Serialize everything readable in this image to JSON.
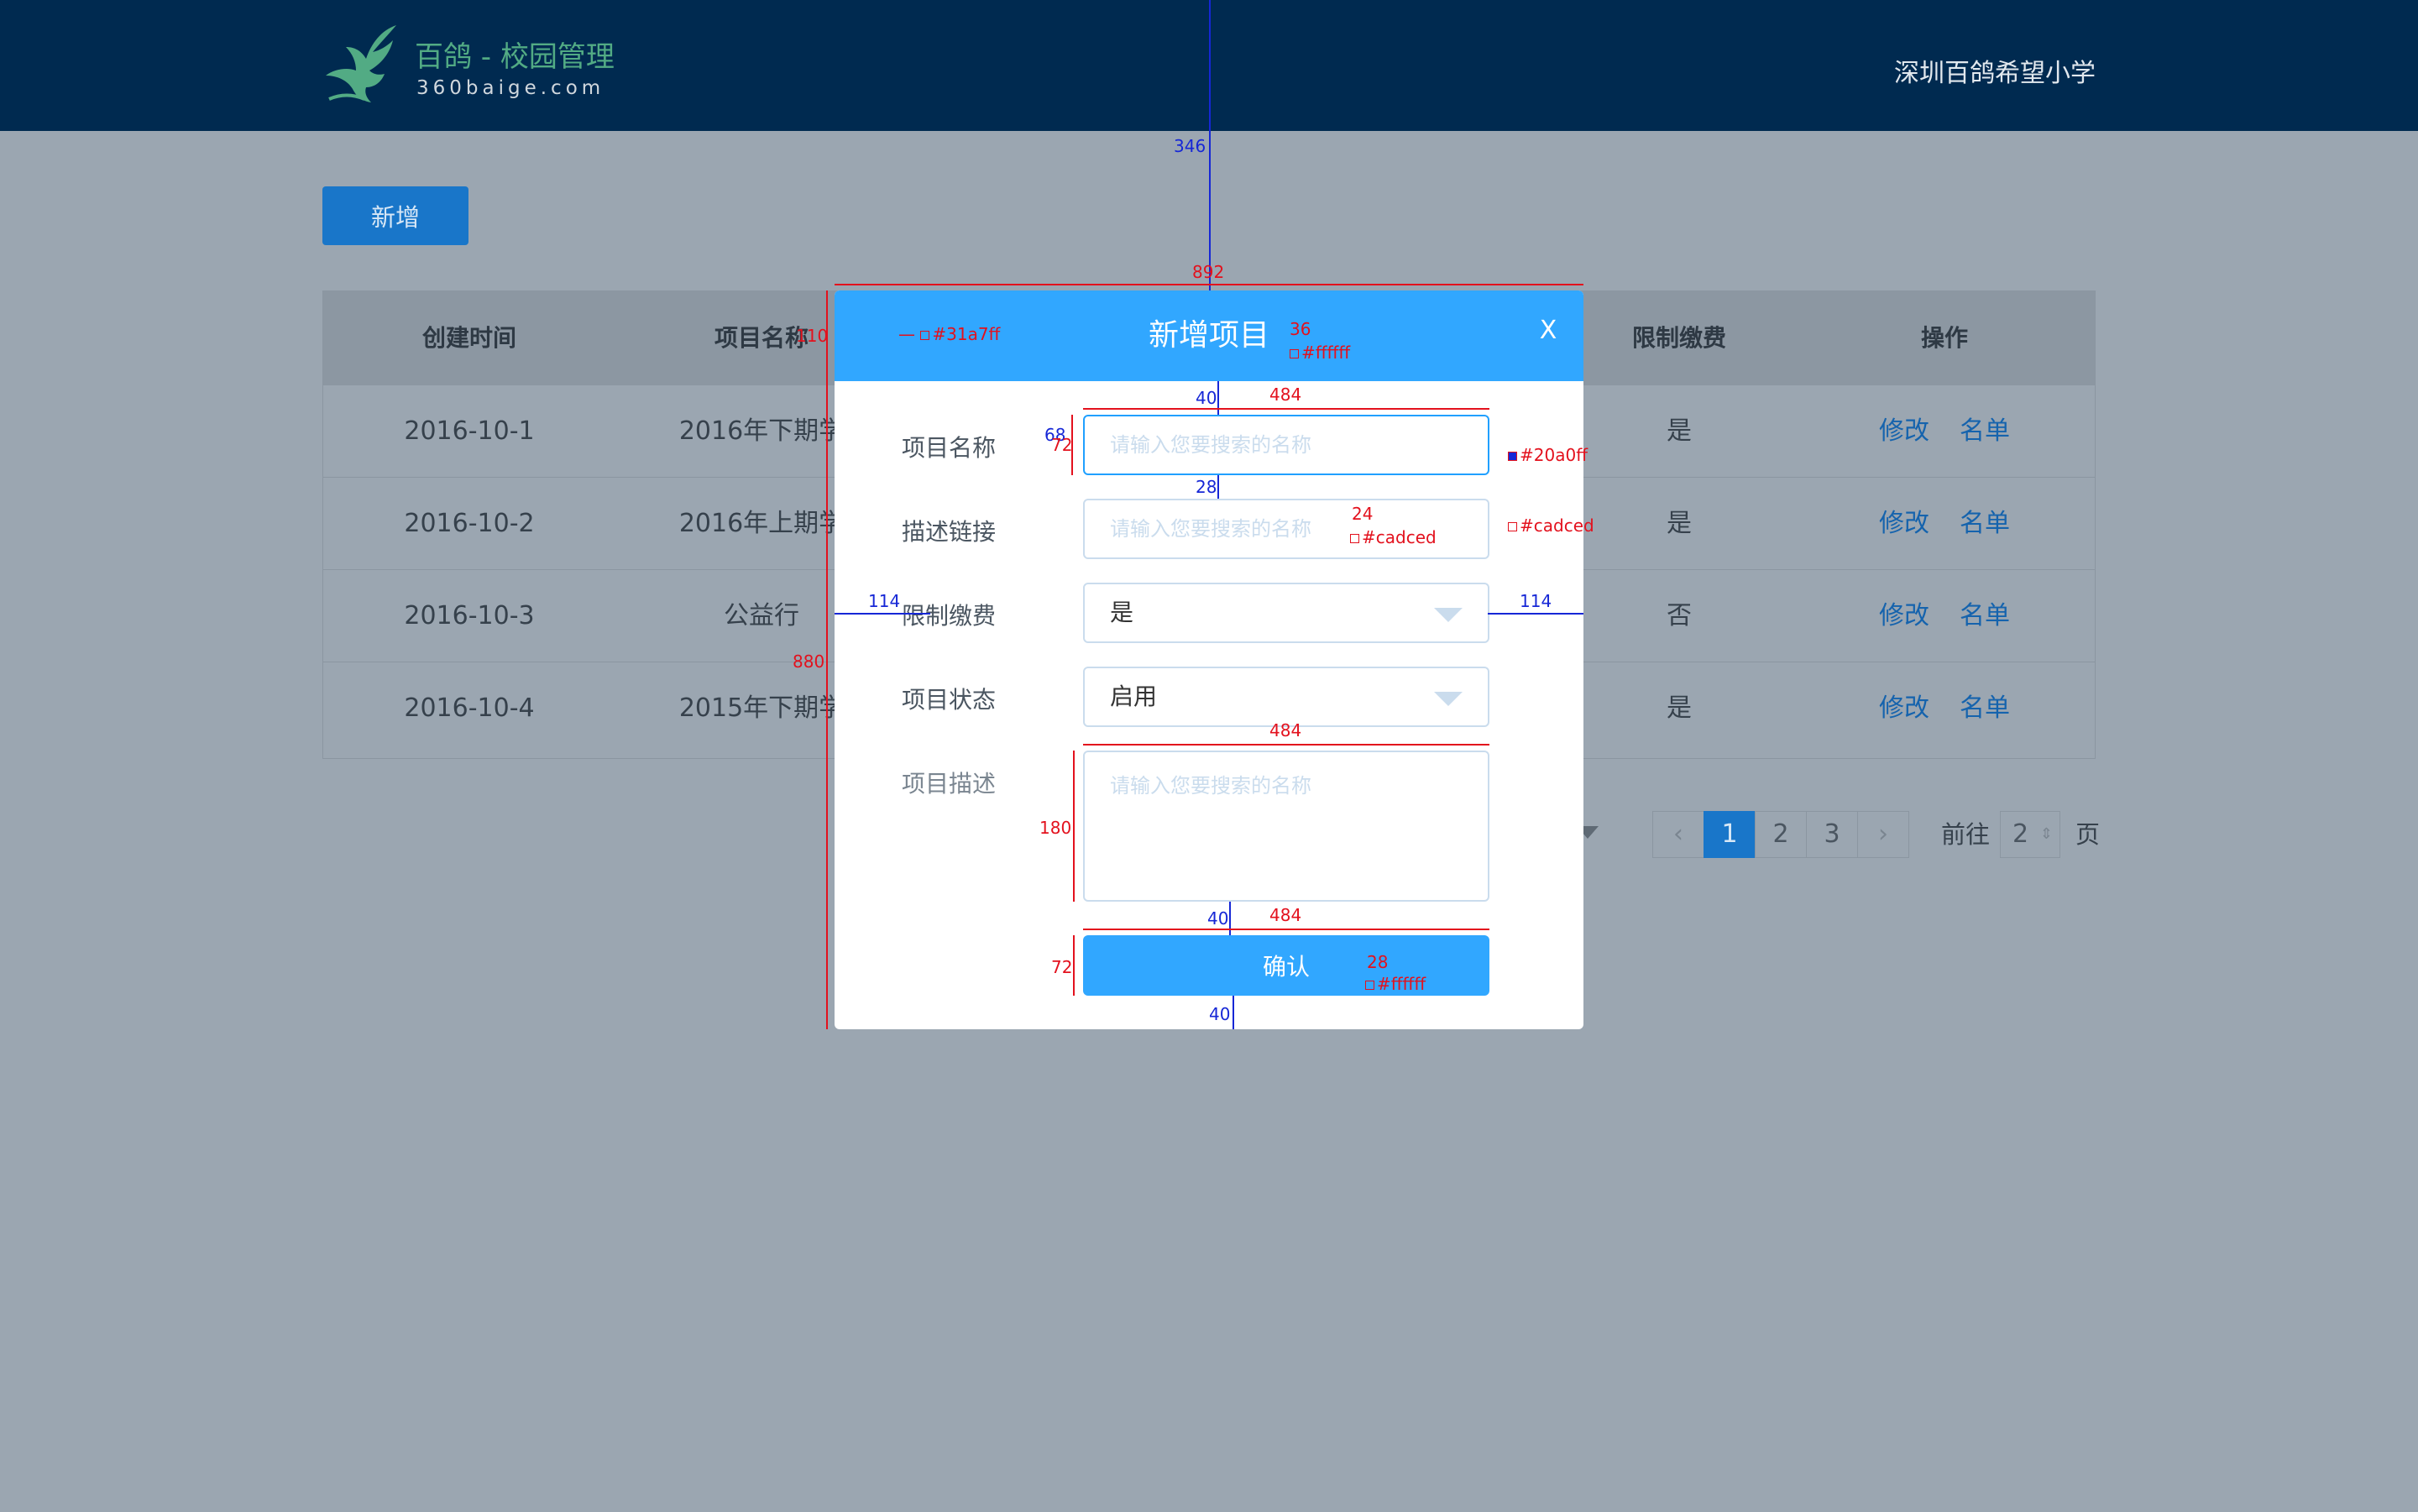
{
  "header": {
    "logo_title": "百鸽 - 校园管理",
    "logo_sub": "360baige.com",
    "school": "深圳百鸽希望小学"
  },
  "toolbar": {
    "add_label": "新增"
  },
  "table": {
    "headers": {
      "created": "创建时间",
      "name": "项目名称",
      "limit": "限制缴费",
      "ops": "操作"
    },
    "rows": [
      {
        "created": "2016-10-1",
        "name": "2016年下期学",
        "limit": "是",
        "edit": "修改",
        "roster": "名单"
      },
      {
        "created": "2016-10-2",
        "name": "2016年上期学",
        "limit": "是",
        "edit": "修改",
        "roster": "名单"
      },
      {
        "created": "2016-10-3",
        "name": "公益行",
        "limit": "否",
        "edit": "修改",
        "roster": "名单"
      },
      {
        "created": "2016-10-4",
        "name": "2015年下期学",
        "limit": "是",
        "edit": "修改",
        "roster": "名单"
      }
    ]
  },
  "pagination": {
    "prev": "‹",
    "pages": [
      "1",
      "2",
      "3"
    ],
    "active_page": "1",
    "next": "›",
    "goto_label": "前往",
    "goto_value": "2",
    "page_label": "页"
  },
  "modal": {
    "title": "新增项目",
    "close": "X",
    "fields": {
      "name_label": "项目名称",
      "name_placeholder": "请输入您要搜索的名称",
      "link_label": "描述链接",
      "link_placeholder": "请输入您要搜索的名称",
      "limit_label": "限制缴费",
      "limit_value": "是",
      "status_label": "项目状态",
      "status_value": "启用",
      "desc_label": "项目描述",
      "desc_placeholder": "请输入您要搜索的名称"
    },
    "confirm_label": "确认"
  },
  "annotations": {
    "dist_346": "346",
    "w_892": "892",
    "h_110": "110",
    "color_head": "#31a7ff",
    "font_36": "36",
    "color_title": "#ffffff",
    "gap_40_a": "40",
    "w_484_a": "484",
    "w_68": "68",
    "h_72_a": "72",
    "color_focus": "#20a0ff",
    "gap_28": "28",
    "font_24": "24",
    "color_ph": "#cadced",
    "color_border": "#cadced",
    "side_114_l": "114",
    "side_114_r": "114",
    "h_880": "880",
    "w_484_b": "484",
    "h_180": "180",
    "gap_40_b": "40",
    "w_484_c": "484",
    "h_72_b": "72",
    "font_28": "28",
    "color_btn": "#ffffff",
    "gap_40_c": "40"
  },
  "colors": {
    "topbar": "#002a50",
    "modal_head": "#31a7ff",
    "input_focus": "#20a0ff",
    "input_border": "#cadced",
    "primary": "#1976c9"
  }
}
